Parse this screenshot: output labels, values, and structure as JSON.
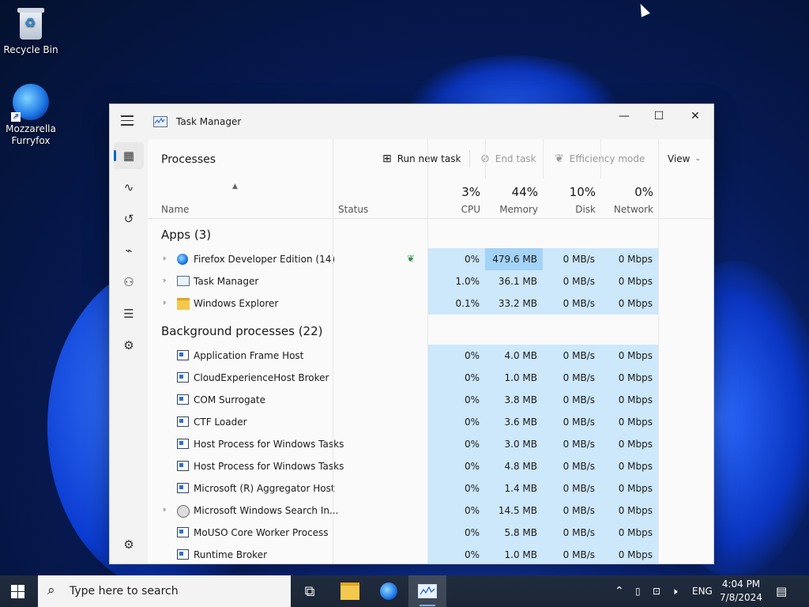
{
  "desktop": {
    "icons": [
      {
        "label": "Recycle Bin"
      },
      {
        "label": "Mozzarella\nFurryfox"
      }
    ]
  },
  "window": {
    "title": "Task Manager",
    "controls": {
      "minimize": "—",
      "maximize": "☐",
      "close": "✕"
    }
  },
  "nav": {
    "items": [
      "processes-icon",
      "performance-icon",
      "app-history-icon",
      "startup-apps-icon",
      "users-icon",
      "details-icon",
      "services-icon",
      "settings-icon"
    ]
  },
  "toolbar": {
    "page_title": "Processes",
    "run_new_task": "Run new task",
    "end_task": "End task",
    "efficiency_mode": "Efficiency mode",
    "view": "View"
  },
  "columns": {
    "name": "Name",
    "status": "Status",
    "cpu": {
      "pct": "3%",
      "label": "CPU"
    },
    "memory": {
      "pct": "44%",
      "label": "Memory"
    },
    "disk": {
      "pct": "10%",
      "label": "Disk"
    },
    "network": {
      "pct": "0%",
      "label": "Network"
    }
  },
  "groups": {
    "apps": "Apps (3)",
    "background": "Background processes (22)"
  },
  "apps": [
    {
      "name": "Firefox Developer Edition (14)",
      "icon": "firefox-icon",
      "cpu": "0%",
      "memory": "479.6 MB",
      "disk": "0 MB/s",
      "network": "0 Mbps",
      "efficiency": true
    },
    {
      "name": "Task Manager",
      "icon": "task-manager-icon",
      "cpu": "1.0%",
      "memory": "36.1 MB",
      "disk": "0 MB/s",
      "network": "0 Mbps"
    },
    {
      "name": "Windows Explorer",
      "icon": "folder-icon",
      "cpu": "0.1%",
      "memory": "33.2 MB",
      "disk": "0 MB/s",
      "network": "0 Mbps"
    }
  ],
  "background": [
    {
      "name": "Application Frame Host",
      "cpu": "0%",
      "memory": "4.0 MB",
      "disk": "0 MB/s",
      "network": "0 Mbps"
    },
    {
      "name": "CloudExperienceHost Broker",
      "cpu": "0%",
      "memory": "1.0 MB",
      "disk": "0 MB/s",
      "network": "0 Mbps"
    },
    {
      "name": "COM Surrogate",
      "cpu": "0%",
      "memory": "3.8 MB",
      "disk": "0 MB/s",
      "network": "0 Mbps"
    },
    {
      "name": "CTF Loader",
      "cpu": "0%",
      "memory": "3.6 MB",
      "disk": "0 MB/s",
      "network": "0 Mbps"
    },
    {
      "name": "Host Process for Windows Tasks",
      "cpu": "0%",
      "memory": "3.0 MB",
      "disk": "0 MB/s",
      "network": "0 Mbps"
    },
    {
      "name": "Host Process for Windows Tasks",
      "cpu": "0%",
      "memory": "4.8 MB",
      "disk": "0 MB/s",
      "network": "0 Mbps"
    },
    {
      "name": "Microsoft (R) Aggregator Host",
      "cpu": "0%",
      "memory": "1.4 MB",
      "disk": "0 MB/s",
      "network": "0 Mbps"
    },
    {
      "name": "Microsoft Windows Search In...",
      "cpu": "0%",
      "memory": "14.5 MB",
      "disk": "0 MB/s",
      "network": "0 Mbps",
      "expandable": true,
      "icon": "user-icon"
    },
    {
      "name": "MoUSO Core Worker Process",
      "cpu": "0%",
      "memory": "5.8 MB",
      "disk": "0 MB/s",
      "network": "0 Mbps"
    },
    {
      "name": "Runtime Broker",
      "cpu": "0%",
      "memory": "1.0 MB",
      "disk": "0 MB/s",
      "network": "0 Mbps"
    }
  ],
  "taskbar": {
    "search_placeholder": "Type here to search",
    "tray": {
      "language": "ENG"
    },
    "clock": {
      "time": "4:04 PM",
      "date": "7/8/2024"
    }
  }
}
